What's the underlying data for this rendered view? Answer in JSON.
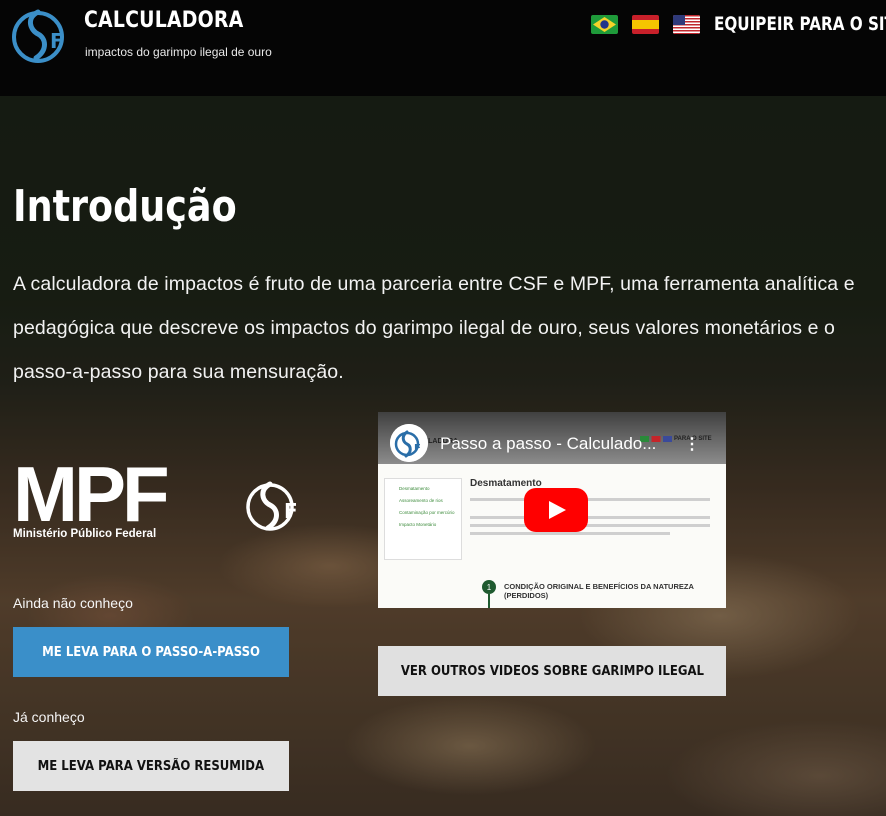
{
  "header": {
    "brand_title": "CALCULADORA",
    "brand_subtitle": "impactos do garimpo ilegal de ouro",
    "logo_text": "CSF",
    "flags": [
      "flag-brazil",
      "flag-spain",
      "flag-usa"
    ],
    "equip_link": "EQUIPEIR PARA O SITE"
  },
  "intro": {
    "title": "Introdução",
    "paragraph": "A calculadora de impactos é fruto de uma parceria entre CSF e MPF, uma ferramenta analítica e pedagógica que descreve os impactos do garimpo ilegal de ouro, seus valores monetários e o passo-a-passo para sua mensuração."
  },
  "partners": {
    "mpf_logo": "MPF",
    "mpf_name": "Ministério Público Federal",
    "csf_logo": "CSF"
  },
  "actions": {
    "label_new": "Ainda não conheço",
    "btn_step": "ME LEVA PARA O PASSO-A-PASSO",
    "label_known": "Já conheço",
    "btn_summary": "ME LEVA PARA VERSÃO RESUMIDA"
  },
  "video": {
    "title": "Passo a passo - Calculado...",
    "preview_header": "CULADORA",
    "preview_equip": "PARA O SITE",
    "preview_heading": "Desmatamento",
    "preview_menu": [
      "Desmatamento",
      "Assoreamento de rios",
      "Contaminação por mercúrio",
      "Impacto Monetário"
    ],
    "preview_step_number": "1",
    "preview_step_text": "CONDIÇÃO ORIGINAL E BENEFÍCIOS DA NATUREZA (PERDIDOS)",
    "btn_more": "VER OUTROS VIDEOS SOBRE GARIMPO ILEGAL"
  }
}
